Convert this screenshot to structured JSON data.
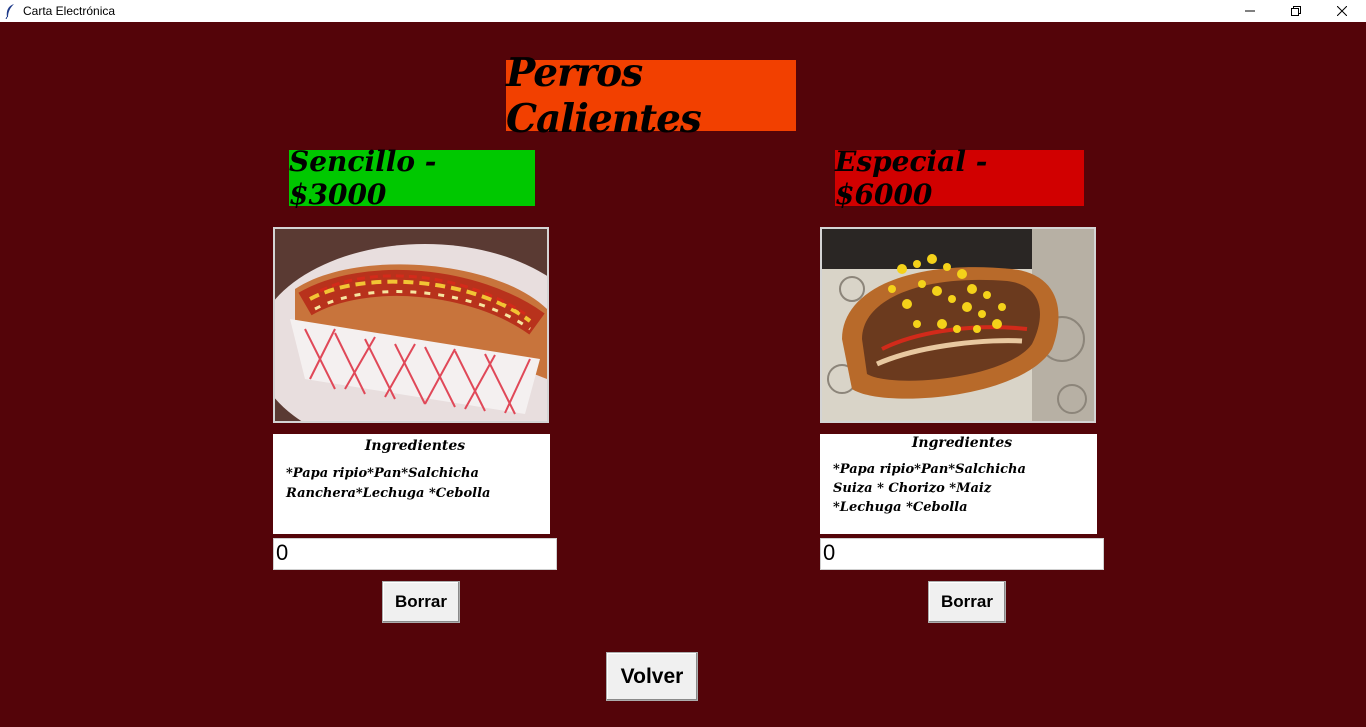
{
  "window": {
    "title": "Carta Electrónica",
    "icon": "feather-icon",
    "controls": [
      "minimize-icon",
      "restore-icon",
      "close-icon"
    ]
  },
  "menu": {
    "title": "Perros Calientes",
    "items": [
      {
        "name": "Sencillo - $3000",
        "tag_color": "#00c800",
        "image": "hotdog-sencillo",
        "ingredients_heading": "Ingredientes",
        "ingredients_text": "*Papa ripio*Pan*Salchicha\nRanchera*Lechuga *Cebolla",
        "quantity": "0",
        "clear_label": "Borrar"
      },
      {
        "name": "Especial - $6000",
        "tag_color": "#d10000",
        "image": "hotdog-especial",
        "ingredients_heading": "Ingredientes",
        "ingredients_text": "*Papa ripio*Pan*Salchicha\nSuiza * Chorizo *Maiz\n*Lechuga *Cebolla",
        "quantity": "0",
        "clear_label": "Borrar"
      }
    ]
  },
  "footer": {
    "back_label": "Volver"
  },
  "colors": {
    "background": "#540409",
    "title_bg": "#f24000"
  }
}
